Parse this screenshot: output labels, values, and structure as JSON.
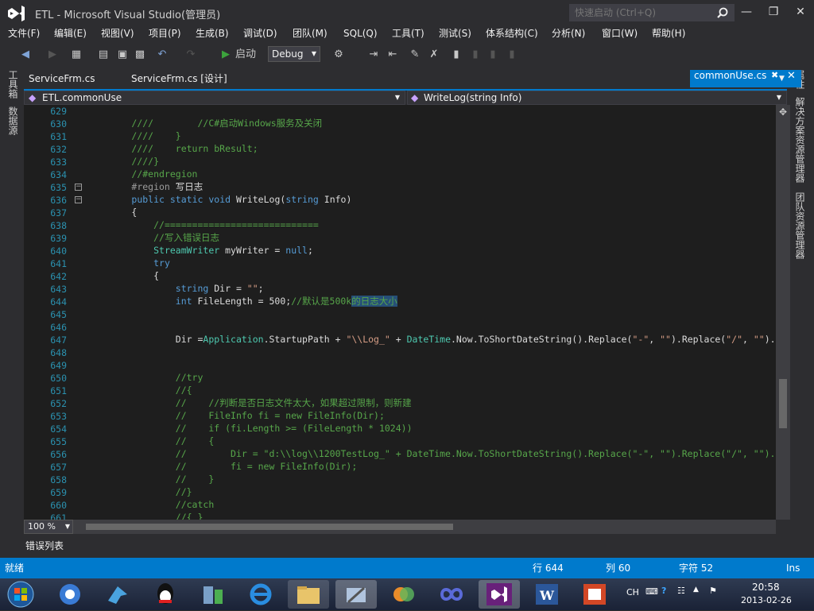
{
  "window": {
    "title": "ETL - Microsoft Visual Studio(管理员)",
    "quick_launch_placeholder": "快速启动 (Ctrl+Q)"
  },
  "menu": [
    "文件(F)",
    "编辑(E)",
    "视图(V)",
    "项目(P)",
    "生成(B)",
    "调试(D)",
    "团队(M)",
    "SQL(Q)",
    "工具(T)",
    "测试(S)",
    "体系结构(C)",
    "分析(N)",
    "窗口(W)",
    "帮助(H)"
  ],
  "toolbar": {
    "start_label": "启动",
    "config": "Debug"
  },
  "left_panels": [
    "工具箱",
    "数据源"
  ],
  "right_panels": [
    "属性",
    "解决方案资源管理器",
    "团队资源管理器"
  ],
  "tabs": {
    "tab1": "ServiceFrm.cs",
    "tab2": "ServiceFrm.cs [设计]",
    "active": "commonUse.cs"
  },
  "nav": {
    "class": "ETL.commonUse",
    "member": "WriteLog(string Info)"
  },
  "code_lines": [
    {
      "n": "629",
      "t": ""
    },
    {
      "n": "630",
      "t": "        ////        //C#启动Windows服务及关闭"
    },
    {
      "n": "631",
      "t": "        ////    }"
    },
    {
      "n": "632",
      "t": "        ////    return bResult;"
    },
    {
      "n": "633",
      "t": "        ////}"
    },
    {
      "n": "634",
      "t": "        //#endregion"
    },
    {
      "n": "635",
      "t": "        #region 写日志"
    },
    {
      "n": "636",
      "t": "        public static void WriteLog(string Info)"
    },
    {
      "n": "637",
      "t": "        {"
    },
    {
      "n": "638",
      "t": "            //============================"
    },
    {
      "n": "639",
      "t": "            //写入错误日志"
    },
    {
      "n": "640",
      "t": "            StreamWriter myWriter = null;"
    },
    {
      "n": "641",
      "t": "            try"
    },
    {
      "n": "642",
      "t": "            {"
    },
    {
      "n": "643",
      "t": "                string Dir = \"\";"
    },
    {
      "n": "644",
      "t": "                int FileLength = 500;//默认是500k的日志大小"
    },
    {
      "n": "645",
      "t": ""
    },
    {
      "n": "646",
      "t": ""
    },
    {
      "n": "647",
      "t": "                Dir =Application.StartupPath + \"\\\\Log_\" + DateTime.Now.ToShortDateString().Replace(\"-\", \"\").Replace(\"/\", \"\")."
    },
    {
      "n": "648",
      "t": ""
    },
    {
      "n": "649",
      "t": ""
    },
    {
      "n": "650",
      "t": "                //try"
    },
    {
      "n": "651",
      "t": "                //{"
    },
    {
      "n": "652",
      "t": "                //    //判断是否日志文件太大，如果超过限制，则新建"
    },
    {
      "n": "653",
      "t": "                //    FileInfo fi = new FileInfo(Dir);"
    },
    {
      "n": "654",
      "t": "                //    if (fi.Length >= (FileLength * 1024))"
    },
    {
      "n": "655",
      "t": "                //    {"
    },
    {
      "n": "656",
      "t": "                //        Dir = \"d:\\\\log\\\\1200TestLog_\" + DateTime.Now.ToShortDateString().Replace(\"-\", \"\").Replace(\"/\", \"\")."
    },
    {
      "n": "657",
      "t": "                //        fi = new FileInfo(Dir);"
    },
    {
      "n": "658",
      "t": "                //    }"
    },
    {
      "n": "659",
      "t": "                //}"
    },
    {
      "n": "660",
      "t": "                //catch"
    },
    {
      "n": "661",
      "t": "                //{ }"
    }
  ],
  "zoom": "100 %",
  "error_list": "错误列表",
  "status": {
    "ready": "就绪",
    "line": "行 644",
    "col": "列 60",
    "char": "字符 52",
    "mode": "Ins"
  },
  "tray": {
    "lang": "CH",
    "time": "20:58",
    "date": "2013-02-26"
  },
  "colors": {
    "accent": "#007acc",
    "chrome": "#2d2d30",
    "editor_bg": "#1e1e1e",
    "keyword": "#569cd6",
    "type": "#4ec9b0",
    "comment": "#57a64a",
    "string": "#d69d85",
    "line_number": "#2b91af"
  }
}
